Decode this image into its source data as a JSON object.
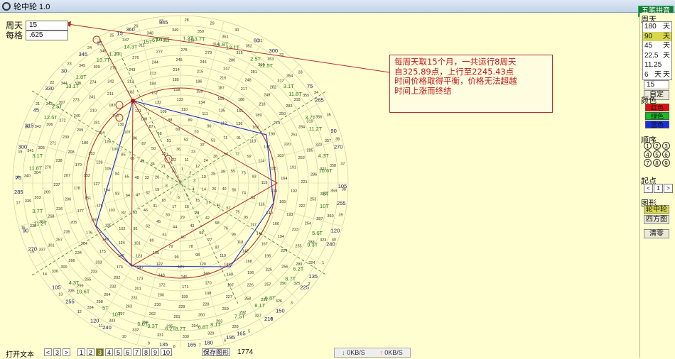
{
  "window": {
    "title": "轮中轮 1.0",
    "ime_label": "五笔拼音"
  },
  "fields": {
    "cycle_label": "周天",
    "cycle_value": "15",
    "step_label": "每格",
    "step_value": ".625"
  },
  "panel": {
    "cycle_title": "周天",
    "cycle_options": [
      {
        "value": "180",
        "unit": "天"
      },
      {
        "value": "90",
        "unit": "天"
      },
      {
        "value": "45",
        "unit": "天"
      },
      {
        "value": "22.5",
        "unit": "天"
      },
      {
        "value": "11.25",
        "unit": "天"
      },
      {
        "value": "6",
        "unit": "天"
      }
    ],
    "selected_cycle": "90",
    "custom_value": "15",
    "custom_button": "自定",
    "color_title": "颜色",
    "colors": [
      {
        "label": "红色",
        "hex": "#e01010"
      },
      {
        "label": "绿色",
        "hex": "#10c020"
      },
      {
        "label": "蓝色",
        "hex": "#1a2ee0"
      }
    ],
    "order_title": "顺序",
    "order_options": [
      "1",
      "2",
      "3",
      "4",
      "5",
      "6",
      "7",
      "8",
      "9"
    ],
    "start_title": "起点",
    "start_value": "1",
    "shape_title": "图形",
    "shape_buttons": [
      "轮中轮",
      "四方图"
    ],
    "clear_button": "清零"
  },
  "annotation": {
    "lines": [
      "每周天取15个月，一共运行8周天",
      "自325.89点，上行至2245.43点",
      "时间价格取得平衡，价格无法超越",
      "时间上涨而终结"
    ]
  },
  "wheel": {
    "outer_labels": [
      {
        "text": "345",
        "ang": -96
      },
      {
        "text": "15",
        "ang": -112
      },
      {
        "text": "60",
        "ang": -62
      },
      {
        "text": "300",
        "ang": -55
      },
      {
        "text": "75",
        "ang": -37
      },
      {
        "text": "285",
        "ang": -31
      },
      {
        "text": "90",
        "ang": -19
      },
      {
        "text": "270",
        "ang": -13
      },
      {
        "text": "105",
        "ang": 1
      },
      {
        "text": "255",
        "ang": 7
      },
      {
        "text": "120",
        "ang": 17
      },
      {
        "text": "240",
        "ang": 22
      },
      {
        "text": "135",
        "ang": 35
      },
      {
        "text": "225",
        "ang": 40
      },
      {
        "text": "150",
        "ang": 52
      },
      {
        "text": "210",
        "ang": 57
      },
      {
        "text": "165",
        "ang": 68
      },
      {
        "text": "195",
        "ang": 72
      },
      {
        "text": "180",
        "ang": 80
      },
      {
        "text": "135",
        "ang": 96
      },
      {
        "text": "165",
        "ang": 86
      },
      {
        "text": "240",
        "ang": 117
      },
      {
        "text": "120",
        "ang": 122
      },
      {
        "text": "255",
        "ang": 133
      },
      {
        "text": "105",
        "ang": 140
      },
      {
        "text": "270",
        "ang": 156
      },
      {
        "text": "90",
        "ang": 163
      },
      {
        "text": "285",
        "ang": 177
      },
      {
        "text": "75",
        "ang": 182
      },
      {
        "text": "300",
        "ang": 193
      },
      {
        "text": "315",
        "ang": 201
      },
      {
        "text": "45",
        "ang": 207
      },
      {
        "text": "330",
        "ang": 216
      },
      {
        "text": "30",
        "ang": 224
      },
      {
        "text": "345",
        "ang": 233
      },
      {
        "text": "15",
        "ang": 240
      },
      {
        "text": "360",
        "ang": 252
      }
    ],
    "green_labels": [
      {
        "text": "14.3T",
        "ang": -97
      },
      {
        "text": "1.2T",
        "ang": -87
      },
      {
        "text": "13.7T",
        "ang": -83
      },
      {
        "text": "1.8T",
        "ang": -73
      },
      {
        "text": "13.1T",
        "ang": -69
      },
      {
        "text": "2.5T",
        "ang": -59
      },
      {
        "text": "12.5T",
        "ang": -54
      },
      {
        "text": "3.1T",
        "ang": -42
      },
      {
        "text": "11.8T",
        "ang": -38
      },
      {
        "text": "3.7T",
        "ang": -27
      },
      {
        "text": "11.2T",
        "ang": -22
      },
      {
        "text": "4.3T",
        "ang": -11
      },
      {
        "text": "10.6T",
        "ang": -5
      },
      {
        "text": "5T",
        "ang": 4
      },
      {
        "text": "10T",
        "ang": 9
      },
      {
        "text": "5.6T",
        "ang": 20
      },
      {
        "text": "9.3T",
        "ang": 25
      },
      {
        "text": "6.2T",
        "ang": 36
      },
      {
        "text": "8.7T",
        "ang": 41
      },
      {
        "text": "6.8T",
        "ang": 52
      },
      {
        "text": "8.1T",
        "ang": 57
      },
      {
        "text": "7.5T",
        "ang": 66
      },
      {
        "text": "8.1T",
        "ang": 76
      },
      {
        "text": "6.8T",
        "ang": 81
      },
      {
        "text": "8.7T",
        "ang": 90
      },
      {
        "text": "6.2T",
        "ang": 94
      },
      {
        "text": "9.3T",
        "ang": 101
      },
      {
        "text": "5.6T",
        "ang": 105
      },
      {
        "text": "10T",
        "ang": 116
      },
      {
        "text": "5T",
        "ang": 121
      },
      {
        "text": "10.6T",
        "ang": 132
      },
      {
        "text": "4.3T",
        "ang": 137
      },
      {
        "text": "11.2T",
        "ang": 164
      },
      {
        "text": "3.7T",
        "ang": 169
      },
      {
        "text": "11.8T",
        "ang": 186
      },
      {
        "text": "3.1T",
        "ang": 191
      },
      {
        "text": "12.5T",
        "ang": 207
      },
      {
        "text": "2.5T",
        "ang": 212
      },
      {
        "text": "13.1T",
        "ang": 222
      },
      {
        "text": "1.8T",
        "ang": 227
      },
      {
        "text": "13.7T",
        "ang": 238
      },
      {
        "text": "1.2T",
        "ang": 243
      },
      {
        "text": "14.3T",
        "ang": 250
      },
      {
        "text": "0T",
        "ang": 262
      },
      {
        "text": "15T",
        "ang": 257
      },
      {
        "text": "6T",
        "ang": -100
      }
    ]
  },
  "bottom": {
    "open_text": "打开文本",
    "pages": [
      "<",
      "3",
      ">",
      "1",
      "2",
      "3",
      "4",
      "5",
      "6",
      "7",
      "8",
      "9",
      "10"
    ],
    "selected_page": "3",
    "save_label": "保存图形",
    "extra": "1774",
    "down_speed": "0KB/S",
    "up_speed": "0KB/S"
  }
}
